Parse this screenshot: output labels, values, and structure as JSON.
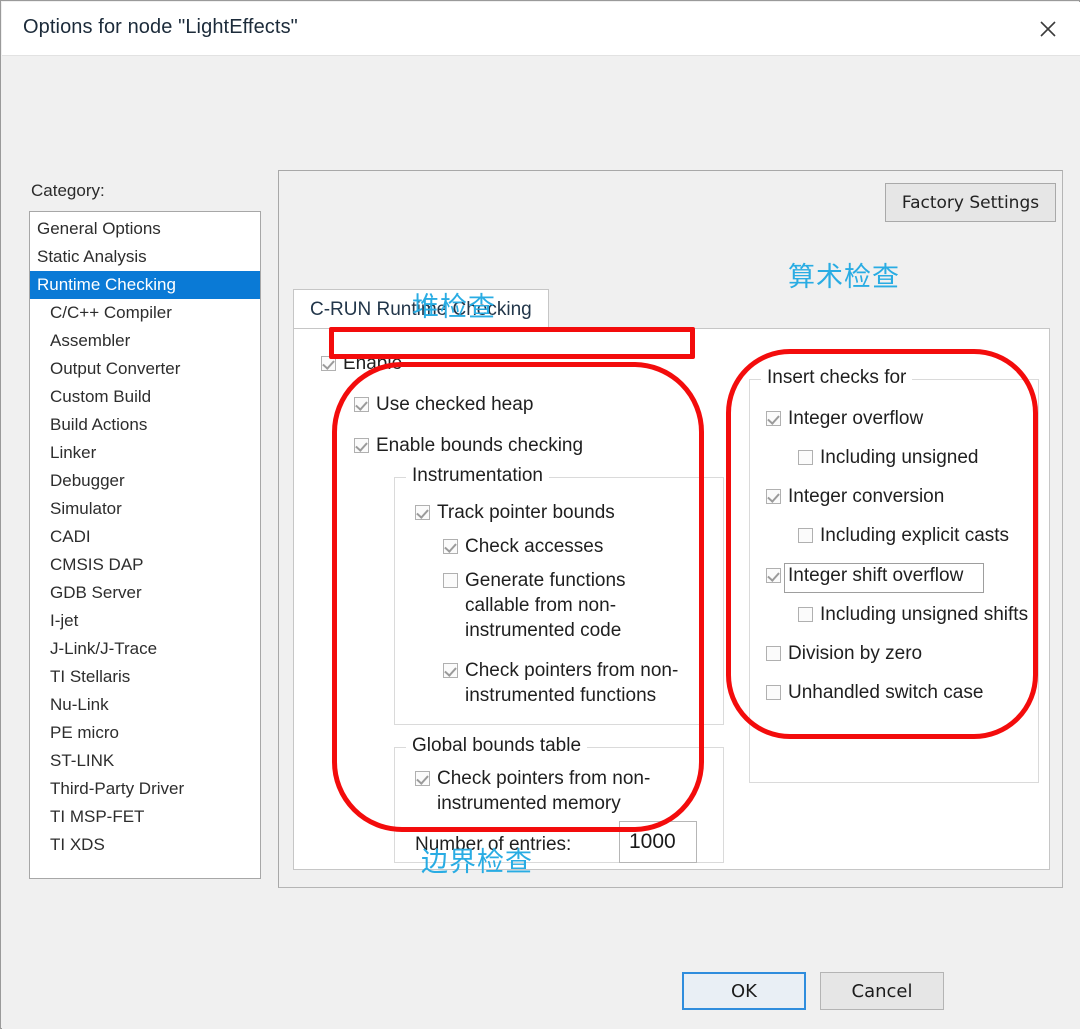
{
  "window": {
    "title": "Options for node \"LightEffects\"",
    "close_icon": "close-icon"
  },
  "category": {
    "label": "Category:",
    "selected": "Runtime Checking",
    "items": [
      {
        "label": "General Options",
        "indent": false,
        "selected": false
      },
      {
        "label": "Static Analysis",
        "indent": false,
        "selected": false
      },
      {
        "label": "Runtime Checking",
        "indent": false,
        "selected": true
      },
      {
        "label": "C/C++ Compiler",
        "indent": true,
        "selected": false
      },
      {
        "label": "Assembler",
        "indent": true,
        "selected": false
      },
      {
        "label": "Output Converter",
        "indent": true,
        "selected": false
      },
      {
        "label": "Custom Build",
        "indent": true,
        "selected": false
      },
      {
        "label": "Build Actions",
        "indent": true,
        "selected": false
      },
      {
        "label": "Linker",
        "indent": true,
        "selected": false
      },
      {
        "label": "Debugger",
        "indent": true,
        "selected": false
      },
      {
        "label": "Simulator",
        "indent": true,
        "selected": false
      },
      {
        "label": "CADI",
        "indent": true,
        "selected": false
      },
      {
        "label": "CMSIS DAP",
        "indent": true,
        "selected": false
      },
      {
        "label": "GDB Server",
        "indent": true,
        "selected": false
      },
      {
        "label": "I-jet",
        "indent": true,
        "selected": false
      },
      {
        "label": "J-Link/J-Trace",
        "indent": true,
        "selected": false
      },
      {
        "label": "TI Stellaris",
        "indent": true,
        "selected": false
      },
      {
        "label": "Nu-Link",
        "indent": true,
        "selected": false
      },
      {
        "label": "PE micro",
        "indent": true,
        "selected": false
      },
      {
        "label": "ST-LINK",
        "indent": true,
        "selected": false
      },
      {
        "label": "Third-Party Driver",
        "indent": true,
        "selected": false
      },
      {
        "label": "TI MSP-FET",
        "indent": true,
        "selected": false
      },
      {
        "label": "TI XDS",
        "indent": true,
        "selected": false
      }
    ]
  },
  "main": {
    "factory_settings_label": "Factory Settings",
    "tab_label": "C-RUN Runtime Checking"
  },
  "options": {
    "enable": {
      "label": "Enable",
      "checked": true
    },
    "use_checked_heap": {
      "label": "Use checked heap",
      "checked": true
    },
    "enable_bounds_checking": {
      "label": "Enable bounds checking",
      "checked": true
    },
    "instrumentation_group": "Instrumentation",
    "track_pointer_bounds": {
      "label": "Track pointer bounds",
      "checked": true
    },
    "check_accesses": {
      "label": "Check accesses",
      "checked": true
    },
    "generate_functions": {
      "label": "Generate functions callable from non-instrumented code",
      "checked": false
    },
    "check_pointers_functions": {
      "label": "Check pointers from non-instrumented functions",
      "checked": true
    },
    "global_bounds_group": "Global bounds table",
    "check_pointers_memory": {
      "label": "Check pointers from non-instrumented memory",
      "checked": true
    },
    "number_of_entries_label": "Number of entries:",
    "number_of_entries_value": "1000"
  },
  "insert_checks": {
    "group_title": "Insert checks for",
    "items": [
      {
        "label": "Integer overflow",
        "checked": true,
        "sub": false,
        "focused": false
      },
      {
        "label": "Including unsigned",
        "checked": false,
        "sub": true,
        "focused": false
      },
      {
        "label": "Integer conversion",
        "checked": true,
        "sub": false,
        "focused": false
      },
      {
        "label": "Including explicit casts",
        "checked": false,
        "sub": true,
        "focused": false
      },
      {
        "label": "Integer shift overflow",
        "checked": true,
        "sub": false,
        "focused": true
      },
      {
        "label": "Including unsigned shifts",
        "checked": false,
        "sub": true,
        "focused": false
      },
      {
        "label": "Division by zero",
        "checked": false,
        "sub": false,
        "focused": false
      },
      {
        "label": "Unhandled switch case",
        "checked": false,
        "sub": false,
        "focused": false
      }
    ]
  },
  "annotations": {
    "color_text": "#29ace3",
    "color_shape": "#f30c0c",
    "heap_check": "堆检查",
    "arithmetic_check": "算术检查",
    "bounds_check": "边界检查"
  },
  "buttons": {
    "ok": "OK",
    "cancel": "Cancel"
  }
}
